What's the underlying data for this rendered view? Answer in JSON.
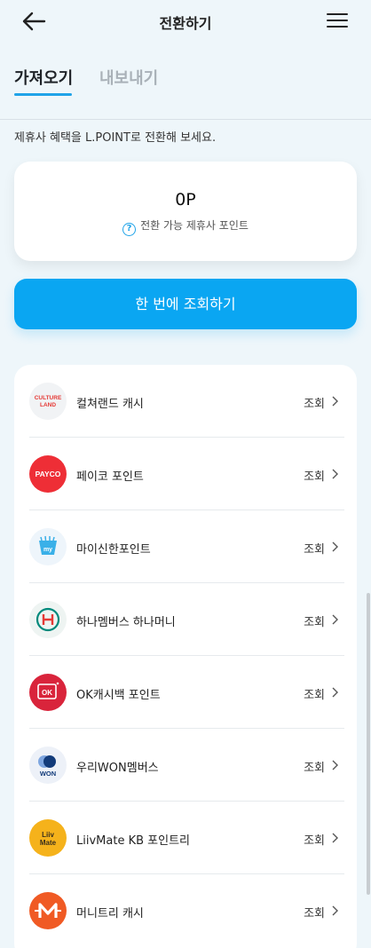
{
  "header": {
    "title": "전환하기"
  },
  "tabs": [
    {
      "label": "가져오기",
      "active": true
    },
    {
      "label": "내보내기",
      "active": false
    }
  ],
  "description": "제휴사 혜택을 L.POINT로 전환해 보세요.",
  "point_card": {
    "value": "0P",
    "label": "전환 가능 제휴사 포인트"
  },
  "query_all_button": "한 번에 조회하기",
  "partners": [
    {
      "name": "컬쳐랜드 캐시",
      "action": "조회",
      "logo_text": "CULTURE LAND"
    },
    {
      "name": "페이코 포인트",
      "action": "조회",
      "logo_text": "PAYCO"
    },
    {
      "name": "마이신한포인트",
      "action": "조회",
      "logo_text": "my"
    },
    {
      "name": "하나멤버스 하나머니",
      "action": "조회",
      "logo_text": "H"
    },
    {
      "name": "OK캐시백 포인트",
      "action": "조회",
      "logo_text": "OK"
    },
    {
      "name": "우리WON멤버스",
      "action": "조회",
      "logo_text": "WON"
    },
    {
      "name": "LiivMate KB 포인트리",
      "action": "조회",
      "logo_text": "Liiv Mate"
    },
    {
      "name": "머니트리 캐시",
      "action": "조회",
      "logo_text": "M"
    }
  ],
  "colors": {
    "accent": "#0aa6f2",
    "background": "#eef6fa"
  }
}
